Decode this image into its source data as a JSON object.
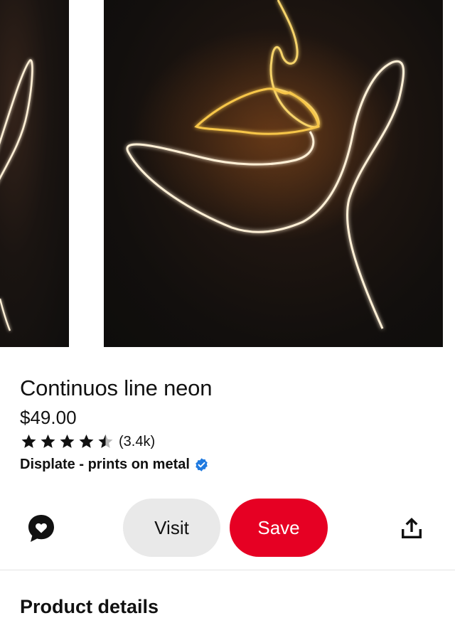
{
  "product": {
    "title": "Continuos line neon",
    "price": "$49.00",
    "rating": 4.5,
    "rating_count": "(3.4k)",
    "seller": "Displate - prints on metal",
    "verified": true
  },
  "images": [
    {
      "description_icon": "neon-line-art-partial"
    },
    {
      "description_icon": "neon-line-face-lips"
    }
  ],
  "actions": {
    "visit_label": "Visit",
    "save_label": "Save",
    "chat_icon": "heart-chat-icon",
    "share_icon": "share-upload-icon"
  },
  "sections": {
    "product_details": "Product details"
  },
  "colors": {
    "save": "#e60023",
    "visit": "#e9e9e9",
    "verified": "#1f7ae0",
    "neon_warm": "#f7c64a",
    "neon_white": "#fff3dc"
  }
}
